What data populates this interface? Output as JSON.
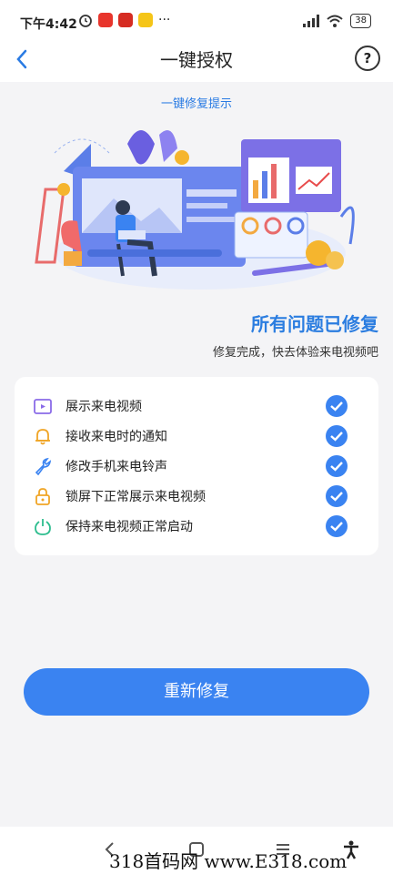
{
  "status_bar": {
    "time": "下午4:42",
    "battery": "38",
    "more": "···"
  },
  "navbar": {
    "title": "一键授权",
    "help_icon": "question-circle-icon",
    "back_icon": "chevron-left-icon"
  },
  "hint_link": "一键修复提示",
  "result": {
    "title": "所有问题已修复",
    "subtitle": "修复完成，快去体验来电视频吧"
  },
  "items": [
    {
      "label": "展示来电视频",
      "icon": "video-icon",
      "color": "#8a6be8"
    },
    {
      "label": "接收来电时的通知",
      "icon": "bell-icon",
      "color": "#f0a526"
    },
    {
      "label": "修改手机来电铃声",
      "icon": "wrench-icon",
      "color": "#3a83f1"
    },
    {
      "label": "锁屏下正常展示来电视频",
      "icon": "lock-icon",
      "color": "#f0a526"
    },
    {
      "label": "保持来电视频正常启动",
      "icon": "power-icon",
      "color": "#2dbd8e"
    }
  ],
  "repair_button": "重新修复",
  "watermark": "318首码网 www.E318.com",
  "colors": {
    "accent": "#3a83f1",
    "title_blue": "#2b7de0",
    "background": "#f4f4f6"
  }
}
